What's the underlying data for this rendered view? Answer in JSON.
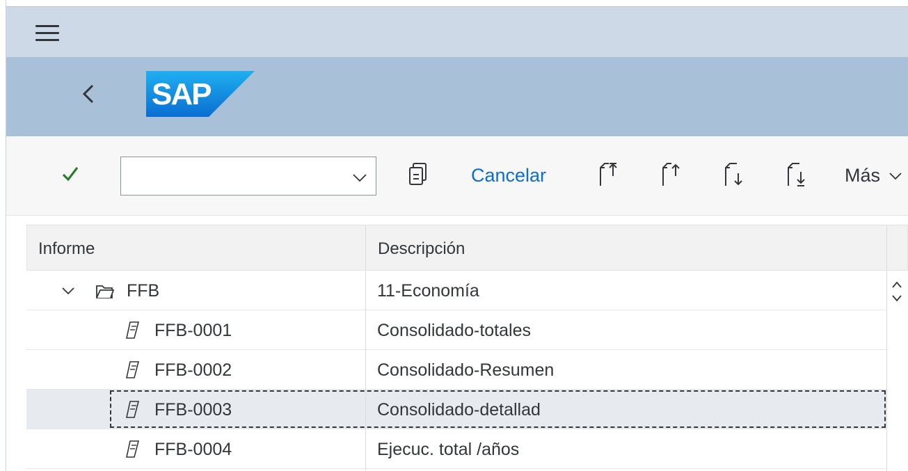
{
  "shell": {
    "menu_icon": "hamburger-icon",
    "back_icon": "chevron-left-icon",
    "logo_text": "SAP",
    "brand_color": "#0a6ed1",
    "header_color": "#a9c1d8",
    "topbar_color": "#cdd9e7"
  },
  "toolbar": {
    "confirm_icon": "checkmark-icon",
    "combo_value": "",
    "combo_placeholder": "",
    "copy_icon": "copy-document-icon",
    "cancel_label": "Cancelar",
    "first_page_icon": "first-page-icon",
    "prev_page_icon": "previous-page-icon",
    "next_page_icon": "next-page-icon",
    "last_page_icon": "last-page-icon",
    "more_label": "Más"
  },
  "tree": {
    "columns": [
      "Informe",
      "Descripción"
    ],
    "rows": [
      {
        "id": "FFB",
        "description": "11-Economía",
        "type": "folder",
        "expanded": true
      },
      {
        "id": "FFB-0001",
        "description": "Consolidado-totales",
        "type": "document"
      },
      {
        "id": "FFB-0002",
        "description": "Consolidado-Resumen",
        "type": "document"
      },
      {
        "id": "FFB-0003",
        "description": "Consolidado-detallad",
        "type": "document",
        "selected": true
      },
      {
        "id": "FFB-0004",
        "description": "Ejecuc. total /años",
        "type": "document"
      }
    ]
  },
  "colors": {
    "check_green": "#2b7d2b",
    "selected_row": "#e7ebf0",
    "link_blue": "#0a6ed1"
  }
}
